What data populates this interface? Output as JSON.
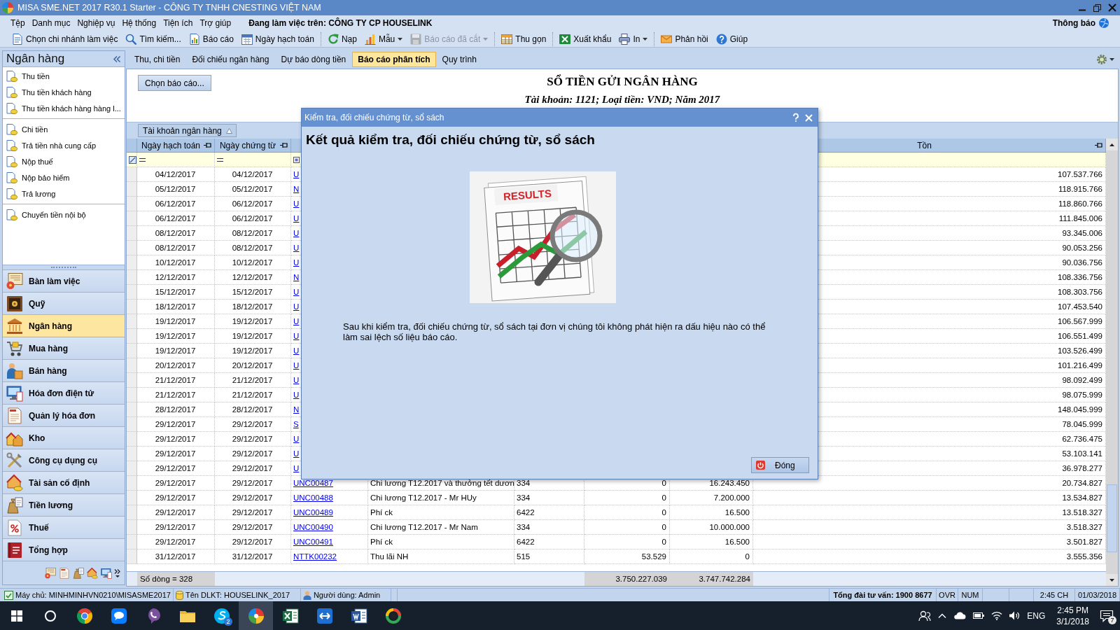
{
  "window": {
    "title": "MISA SME.NET 2017 R30.1 Starter - CÔNG TY TNHH CNESTING VIỆT NAM"
  },
  "menu": {
    "items": [
      "Tệp",
      "Danh mục",
      "Nghiệp vụ",
      "Hệ thống",
      "Tiện ích",
      "Trợ giúp"
    ],
    "workspace": "Đang làm việc trên: CÔNG TY CP HOUSELINK",
    "notifications": "Thông báo"
  },
  "toolbar": {
    "groups": [
      {
        "buttons": [
          {
            "label": "Chọn chi nhánh làm việc",
            "dropdown": false,
            "disabled": false
          },
          {
            "label": "Tìm kiếm...",
            "dropdown": false,
            "disabled": false
          },
          {
            "label": "Báo cáo",
            "dropdown": false,
            "disabled": false
          },
          {
            "label": "Ngày hạch toán",
            "dropdown": false,
            "disabled": false
          }
        ]
      },
      {
        "buttons": [
          {
            "label": "Nạp",
            "dropdown": false,
            "disabled": false
          },
          {
            "label": "Mẫu",
            "dropdown": true,
            "disabled": false
          },
          {
            "label": "Báo cáo đã cắt",
            "dropdown": true,
            "disabled": true
          }
        ]
      },
      {
        "buttons": [
          {
            "label": "Thu gọn",
            "dropdown": false,
            "disabled": false
          }
        ]
      },
      {
        "buttons": [
          {
            "label": "Xuất khẩu",
            "dropdown": false,
            "disabled": false
          },
          {
            "label": "In",
            "dropdown": true,
            "disabled": false
          }
        ]
      },
      {
        "buttons": [
          {
            "label": "Phản hồi",
            "dropdown": false,
            "disabled": false
          },
          {
            "label": "Giúp",
            "dropdown": false,
            "disabled": false
          }
        ]
      }
    ]
  },
  "sidebar": {
    "title": "Ngân hàng",
    "groups": [
      {
        "items": [
          "Thu tiền",
          "Thu tiền khách hàng",
          "Thu tiền khách hàng hàng l..."
        ]
      },
      {
        "items": [
          "Chi tiền",
          "Trả tiền nhà cung cấp",
          "Nộp thuế",
          "Nộp bảo hiểm",
          "Trả lương"
        ]
      },
      {
        "items": [
          "Chuyển tiền nội bộ"
        ]
      }
    ],
    "modules": [
      {
        "label": "Bàn làm việc",
        "selected": false
      },
      {
        "label": "Quỹ",
        "selected": false
      },
      {
        "label": "Ngân hàng",
        "selected": true
      },
      {
        "label": "Mua hàng",
        "selected": false
      },
      {
        "label": "Bán hàng",
        "selected": false
      },
      {
        "label": "Hóa đơn điện tử",
        "selected": false
      },
      {
        "label": "Quản lý hóa đơn",
        "selected": false
      },
      {
        "label": "Kho",
        "selected": false
      },
      {
        "label": "Công cụ dụng cụ",
        "selected": false
      },
      {
        "label": "Tài sản cố định",
        "selected": false
      },
      {
        "label": "Tiền lương",
        "selected": false
      },
      {
        "label": "Thuế",
        "selected": false
      },
      {
        "label": "Tổng hợp",
        "selected": false
      }
    ]
  },
  "tabs": [
    {
      "label": "Thu, chi tiền",
      "selected": false
    },
    {
      "label": "Đối chiếu ngân hàng",
      "selected": false
    },
    {
      "label": "Dự báo dòng tiền",
      "selected": false
    },
    {
      "label": "Báo cáo phân tích",
      "selected": true
    },
    {
      "label": "Quy trình",
      "selected": false
    }
  ],
  "report": {
    "choose_button": "Chọn báo cáo...",
    "title": "SỔ TIỀN GỬI NGÂN HÀNG",
    "subtitle": "Tài khoản: 1121; Loại tiền: VND; Năm 2017"
  },
  "grid": {
    "group_by": "Tài khoản ngân hàng",
    "columns": {
      "posting_date": "Ngày hạch toán",
      "voucher_date": "Ngày chứng từ",
      "balance": "Tồn"
    },
    "rows": [
      {
        "posting_date": "04/12/2017",
        "voucher_date": "04/12/2017",
        "column_3": "U",
        "balance": "107.537.766"
      },
      {
        "posting_date": "05/12/2017",
        "voucher_date": "05/12/2017",
        "column_3": "N",
        "balance": "118.915.766"
      },
      {
        "posting_date": "06/12/2017",
        "voucher_date": "06/12/2017",
        "column_3": "U",
        "balance": "118.860.766"
      },
      {
        "posting_date": "06/12/2017",
        "voucher_date": "06/12/2017",
        "column_3": "U",
        "balance": "111.845.006"
      },
      {
        "posting_date": "08/12/2017",
        "voucher_date": "08/12/2017",
        "column_3": "U",
        "balance": "93.345.006"
      },
      {
        "posting_date": "08/12/2017",
        "voucher_date": "08/12/2017",
        "column_3": "U",
        "balance": "90.053.256"
      },
      {
        "posting_date": "10/12/2017",
        "voucher_date": "10/12/2017",
        "column_3": "U",
        "balance": "90.036.756"
      },
      {
        "posting_date": "12/12/2017",
        "voucher_date": "12/12/2017",
        "column_3": "N",
        "balance": "108.336.756"
      },
      {
        "posting_date": "15/12/2017",
        "voucher_date": "15/12/2017",
        "column_3": "U",
        "balance": "108.303.756"
      },
      {
        "posting_date": "18/12/2017",
        "voucher_date": "18/12/2017",
        "column_3": "U",
        "balance": "107.453.540"
      },
      {
        "posting_date": "19/12/2017",
        "voucher_date": "19/12/2017",
        "column_3": "U",
        "balance": "106.567.999"
      },
      {
        "posting_date": "19/12/2017",
        "voucher_date": "19/12/2017",
        "column_3": "U",
        "balance": "106.551.499"
      },
      {
        "posting_date": "19/12/2017",
        "voucher_date": "19/12/2017",
        "column_3": "U",
        "balance": "103.526.499"
      },
      {
        "posting_date": "20/12/2017",
        "voucher_date": "20/12/2017",
        "column_3": "U",
        "balance": "101.216.499"
      },
      {
        "posting_date": "21/12/2017",
        "voucher_date": "21/12/2017",
        "column_3": "U",
        "balance": "98.092.499"
      },
      {
        "posting_date": "21/12/2017",
        "voucher_date": "21/12/2017",
        "column_3": "U",
        "balance": "98.075.999"
      },
      {
        "posting_date": "28/12/2017",
        "voucher_date": "28/12/2017",
        "column_3": "N",
        "balance": "148.045.999"
      },
      {
        "posting_date": "29/12/2017",
        "voucher_date": "29/12/2017",
        "column_3": "S",
        "balance": "78.045.999"
      },
      {
        "posting_date": "29/12/2017",
        "voucher_date": "29/12/2017",
        "column_3": "U",
        "balance": "62.736.475"
      },
      {
        "posting_date": "29/12/2017",
        "voucher_date": "29/12/2017",
        "column_3": "U",
        "balance": "53.103.141"
      },
      {
        "posting_date": "29/12/2017",
        "voucher_date": "29/12/2017",
        "column_3": "U",
        "balance": "36.978.277"
      },
      {
        "posting_date": "29/12/2017",
        "voucher_date": "29/12/2017",
        "column_3": "UNC00487",
        "column_4": "Chi lương T12.2017 và thưởng tết dươn",
        "column_5": "334",
        "column_6": "0",
        "column_7": "16.243.450",
        "balance": "20.734.827"
      },
      {
        "posting_date": "29/12/2017",
        "voucher_date": "29/12/2017",
        "column_3": "UNC00488",
        "column_4": "Chi lương T12.2017 - Mr HUy",
        "column_5": "334",
        "column_6": "0",
        "column_7": "7.200.000",
        "balance": "13.534.827"
      },
      {
        "posting_date": "29/12/2017",
        "voucher_date": "29/12/2017",
        "column_3": "UNC00489",
        "column_4": "Phí ck",
        "column_5": "6422",
        "column_6": "0",
        "column_7": "16.500",
        "balance": "13.518.327"
      },
      {
        "posting_date": "29/12/2017",
        "voucher_date": "29/12/2017",
        "column_3": "UNC00490",
        "column_4": "Chi lương T12.2017 - Mr Nam",
        "column_5": "334",
        "column_6": "0",
        "column_7": "10.000.000",
        "balance": "3.518.327"
      },
      {
        "posting_date": "29/12/2017",
        "voucher_date": "29/12/2017",
        "column_3": "UNC00491",
        "column_4": "Phí ck",
        "column_5": "6422",
        "column_6": "0",
        "column_7": "16.500",
        "balance": "3.501.827"
      },
      {
        "posting_date": "31/12/2017",
        "voucher_date": "31/12/2017",
        "column_3": "NTTK00232",
        "column_4": "Thu lãi NH",
        "column_5": "515",
        "column_6": "53.529",
        "column_7": "0",
        "balance": "3.555.356"
      }
    ],
    "footer": {
      "row_count": "Số dòng = 328",
      "column_6": "3.750.227.039",
      "column_7": "3.747.742.284"
    }
  },
  "dialog": {
    "title": "Kiểm tra, đối chiếu chứng từ, sổ sách",
    "heading": "Kết quả kiểm tra, đối chiếu chứng từ, sổ sách",
    "illustration_caption": "RESULTS",
    "message": "Sau khi kiểm tra, đối chiếu chứng từ, sổ sách tại đơn vị chúng tôi không phát hiện ra dấu hiệu nào có thể làm sai lệch số liệu báo cáo.",
    "button": "Đóng"
  },
  "status_bar": {
    "server": "Máy chủ: MINHMINHVN0210\\MISASME2017",
    "database": "Tên DLKT: HOUSELINK_2017",
    "user": "Người dùng: Admin",
    "hotline": "Tổng đài tư vấn: 1900 8677",
    "ovr": "OVR",
    "num": "NUM",
    "time": "2:45 CH",
    "date": "01/03/2018"
  },
  "taskbar": {
    "apps": [
      {
        "selected": false
      },
      {
        "selected": false
      },
      {
        "selected": false
      },
      {
        "selected": false
      },
      {
        "selected": false,
        "badge": "2"
      },
      {
        "selected": true
      },
      {
        "selected": false
      },
      {
        "selected": false
      },
      {
        "selected": false
      },
      {
        "selected": false
      }
    ],
    "tray": {
      "language": "ENG",
      "time": "2:45 PM",
      "date": "3/1/2018",
      "notification_count": "7"
    }
  }
}
